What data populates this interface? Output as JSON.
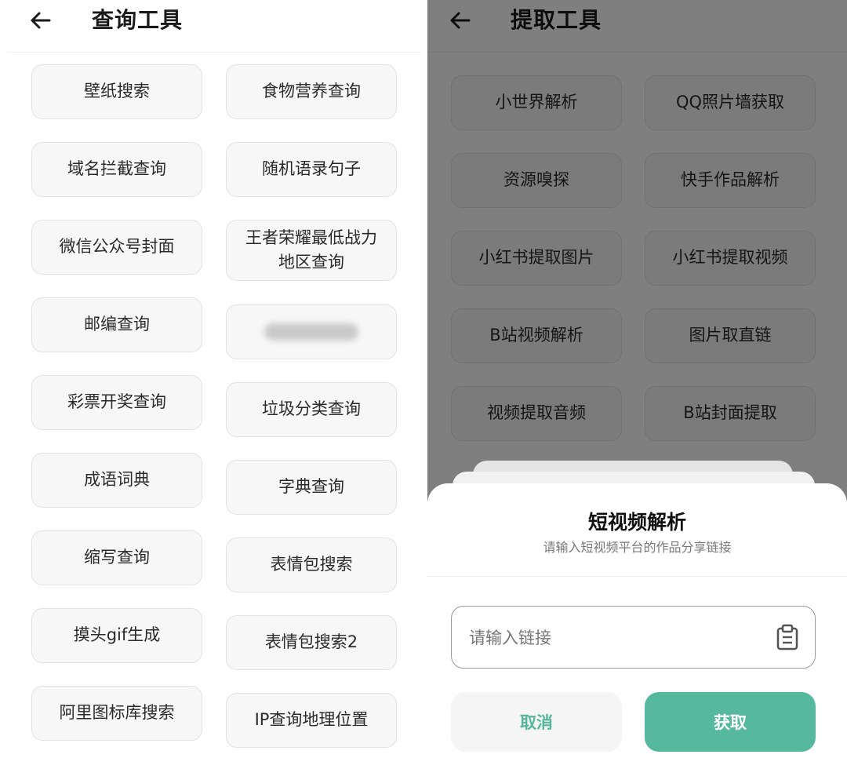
{
  "left": {
    "title": "查询工具",
    "buttons": [
      "壁纸搜索",
      "食物营养查询",
      "域名拦截查询",
      "随机语录句子",
      "微信公众号封面",
      "王者荣耀最低战力地区查询",
      "邮编查询",
      "",
      "彩票开奖查询",
      "垃圾分类查询",
      "成语词典",
      "字典查询",
      "缩写查询",
      "表情包搜索",
      "摸头gif生成",
      "表情包搜索2",
      "阿里图标库搜索",
      "IP查询地理位置"
    ]
  },
  "right": {
    "title": "提取工具",
    "buttons": [
      "小世界解析",
      "QQ照片墙获取",
      "资源嗅探",
      "快手作品解析",
      "小红书提取图片",
      "小红书提取视频",
      "B站视频解析",
      "图片取直链",
      "视频提取音频",
      "B站封面提取"
    ],
    "dialog": {
      "title": "短视频解析",
      "subtitle": "请输入短视频平台的作品分享链接",
      "input_placeholder": "请输入链接",
      "input_value": "",
      "cancel_label": "取消",
      "confirm_label": "获取"
    }
  },
  "colors": {
    "accent": "#56b99e",
    "overlay": "rgba(0,0,0,0.5)"
  },
  "icons": {
    "back": "back-arrow-icon",
    "clipboard": "clipboard-icon"
  }
}
